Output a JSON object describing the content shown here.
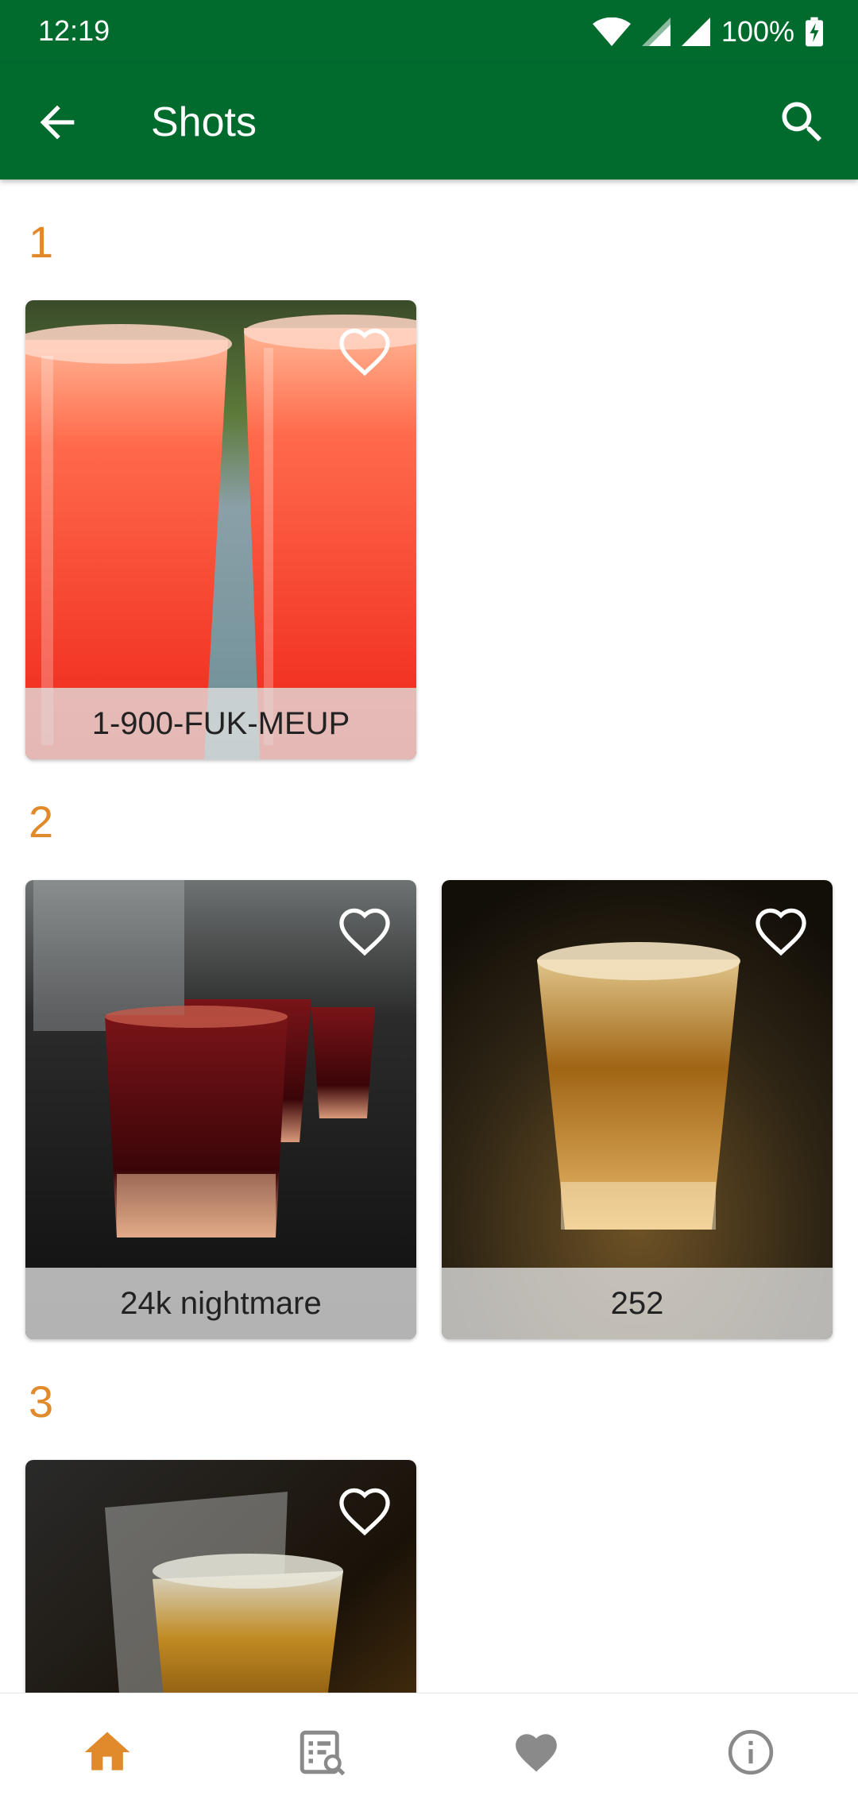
{
  "status_bar": {
    "time": "12:19",
    "battery": "100%"
  },
  "app_bar": {
    "title": "Shots"
  },
  "sections": [
    {
      "title": "1",
      "cards": [
        {
          "label": "1-900-FUK-MEUP"
        }
      ]
    },
    {
      "title": "2",
      "cards": [
        {
          "label": "24k nightmare"
        },
        {
          "label": "252"
        }
      ]
    },
    {
      "title": "3",
      "cards": [
        {
          "label": ""
        }
      ]
    }
  ],
  "colors": {
    "primary": "#006b2d",
    "accent": "#e08a2c",
    "nav_inactive": "#8a8a8a"
  },
  "bottom_nav": {
    "items": [
      {
        "icon": "home-icon",
        "active": true
      },
      {
        "icon": "search-list-icon",
        "active": false
      },
      {
        "icon": "heart-icon",
        "active": false
      },
      {
        "icon": "info-icon",
        "active": false
      }
    ]
  }
}
